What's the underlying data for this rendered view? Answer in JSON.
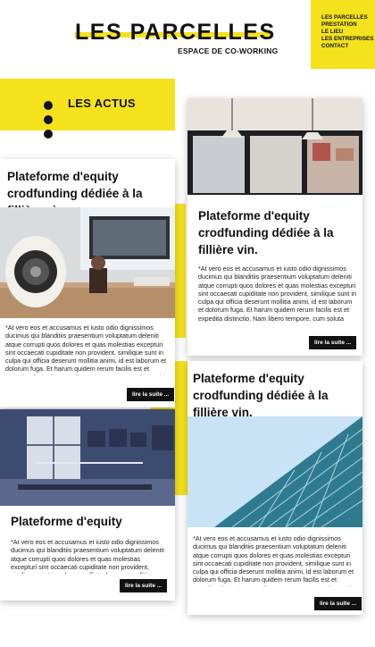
{
  "header": {
    "logo_text": "LES PARCELLES",
    "subtitle": "ESPACE DE CO-WORKING"
  },
  "nav": {
    "items": [
      "LES PARCELLES",
      "PRESTATION",
      "LE LIEU",
      "LES ENTREPRISES",
      "CONTACT"
    ]
  },
  "actus": {
    "title": "LES ACTUS"
  },
  "cards": [
    {
      "title": "Plateforme d'equity crodfunding dédiée à la fillière vin.",
      "text": "*At vero eos et accusamus et iusto odio dignissimos ducimus qui blanditiis praesentium voluptatum deleniti atque corrupti quos dolores et quas molestias excepturi sint occaecati cupiditate non provident, similique sunt in culpa qui officia deserunt mollitia animi, id est laborum et dolorum fuga. Et harum quidem rerum facilis est et expedita distinctio. Nam libero tempore, cum soluta nobis est eligendi opti",
      "button": "lire la suite ..."
    },
    {
      "title": "Plateforme d'equity crodfunding dédiée à la fillière vin.",
      "text": "*At vero eos et accusamus et iusto odio dignissimos ducimus qui blanditiis praesentium voluptatum deleniti atque corrupti quos dolores et quas molestias excepturi sint occaecati cupiditate non provident, similique sunt in culpa qui officia deserunt mollitia animi, id est laborum et dolorum fuga. Et harum quidem rerum facilis est et expedita distinctio. Nam libero tempore, cum soluta nobis est eligendi optio ...",
      "button": "lire la suite ..."
    },
    {
      "title": "Plateforme d'equity",
      "text": "*At vero eos et accusamus et iusto odio dignissimos ducimus qui blanditiis praesentium voluptatum deleniti atque corrupti quos dolores et quas molestias excepturi sint occaecati cupiditate non provident, similique sunt in culpa qui officia deserunt mollitia animi, id est laborum et dolorum fuga. Et harum quidem rerum facilis est et expedita distinctio. Nam libero tempore, cum soluta nobis est eligendi optio ...",
      "button": "lire la suite ..."
    },
    {
      "title": "Plateforme d'equity crodfunding dédiée à la fillière vin.",
      "text": "*At vero eos et accusamus et iusto odio dignissimos ducimus qui blanditiis praesentium voluptatum deleniti atque corrupti quos dolores et quas molestias excepturi sint occaecati cupiditate non provident, similique sunt in culpa qui officia deserunt mollitia animi, id est laborum et dolorum fuga. Et harum quidem rerum facilis est et expedita distinctio. Nam libero tempore, cum soluta nobis est eligendi optio",
      "button": "lire la suite ..."
    }
  ],
  "colors": {
    "accent": "#f4e21c",
    "text": "#111111"
  }
}
